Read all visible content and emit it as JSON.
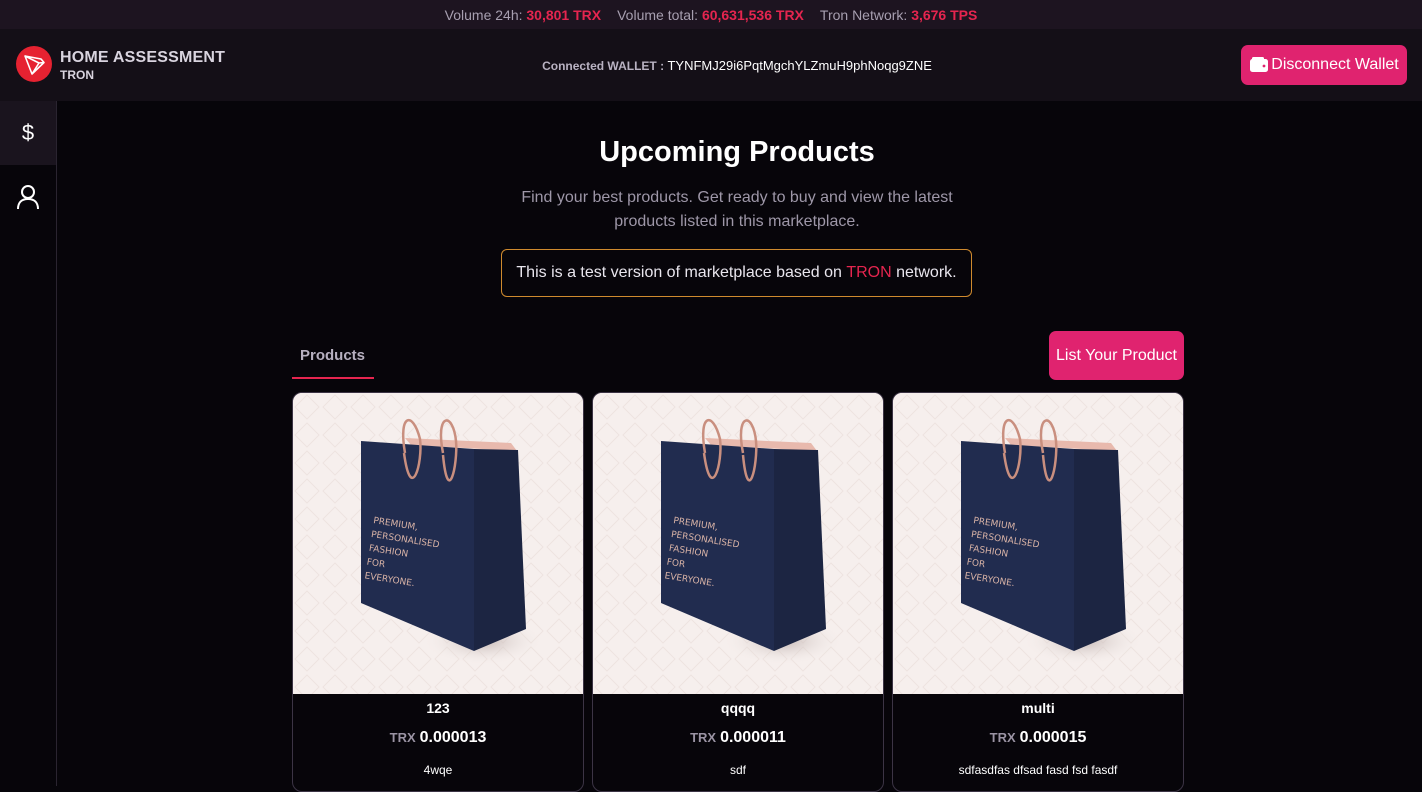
{
  "stats": {
    "volume24h_label": "Volume 24h:",
    "volume24h_value": "30,801 TRX",
    "volume_total_label": "Volume total:",
    "volume_total_value": "60,631,536 TRX",
    "network_label": "Tron Network:",
    "network_value": "3,676 TPS"
  },
  "header": {
    "brand_title": "HOME ASSESSMENT",
    "brand_sub": "TRON",
    "wallet_label": "Connected WALLET :",
    "wallet_address": "TYNFMJ29i6PqtMgchYLZmuH9phNoqg9ZNE",
    "disconnect_label": "Disconnect Wallet"
  },
  "sidebar": {
    "items": [
      {
        "icon": "dollar-icon",
        "glyph": "$"
      },
      {
        "icon": "user-icon"
      }
    ]
  },
  "main": {
    "title": "Upcoming Products",
    "subtitle_line1": "Find your best products. Get ready to buy and view the latest",
    "subtitle_line2": "products listed in this marketplace.",
    "notice_pre": "This is a test version of marketplace based on ",
    "notice_highlight": "TRON",
    "notice_post": " network.",
    "tab_label": "Products",
    "list_button": "List Your Product"
  },
  "products": [
    {
      "name": "123",
      "currency": "TRX",
      "price": "0.000013",
      "description": "4wqe"
    },
    {
      "name": "qqqq",
      "currency": "TRX",
      "price": "0.000011",
      "description": "sdf"
    },
    {
      "name": "multi",
      "currency": "TRX",
      "price": "0.000015",
      "description": "sdfasdfas dfsad fasd fsd fasdf"
    }
  ],
  "product_image": {
    "bag_text": [
      "PREMIUM,",
      "PERSONALISED",
      "FASHION",
      "FOR",
      "EVERYONE."
    ]
  },
  "colors": {
    "accent_pink": "#e0236f",
    "accent_red": "#e5254f",
    "notice_border": "#cf8a2e",
    "background": "#07050a"
  }
}
